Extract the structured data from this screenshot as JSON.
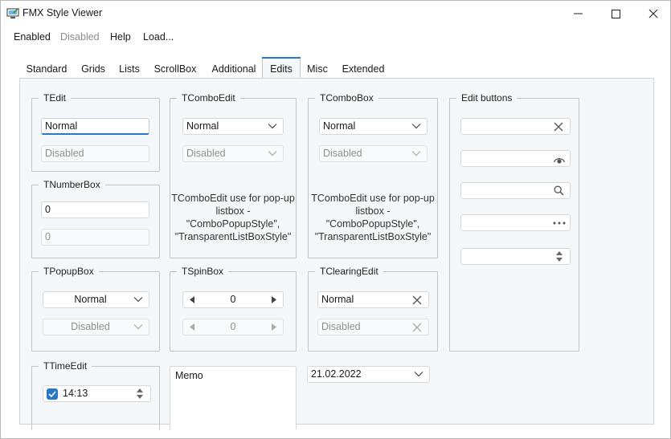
{
  "window": {
    "title": "FMX Style Viewer"
  },
  "menu": {
    "items": [
      "Enabled",
      "Disabled",
      "Help",
      "Load..."
    ]
  },
  "tabs": [
    "Standard",
    "Grids",
    "Lists",
    "ScrollBox",
    "Additional",
    "Edits",
    "Misc",
    "Extended"
  ],
  "active_tab": "Edits",
  "tedit": {
    "label": "TEdit",
    "normal_value": "Normal",
    "disabled_value": "Disabled"
  },
  "tnumberbox": {
    "label": "TNumberBox",
    "value": "0",
    "disabled_value": "0"
  },
  "tpopupbox": {
    "label": "TPopupBox",
    "normal_value": "Normal",
    "disabled_value": "Disabled"
  },
  "ttimeedit": {
    "label": "TTimeEdit",
    "value": "14:13"
  },
  "tcomboedit": {
    "label": "TComboEdit",
    "normal_value": "Normal",
    "disabled_value": "Disabled",
    "note_lines": [
      "TComboEdit use for pop-up",
      "listbox -",
      "\"ComboPopupStyle\",",
      "\"TransparentListBoxStyle\""
    ]
  },
  "tspinbox": {
    "label": "TSpinBox",
    "value": "0",
    "disabled_value": "0"
  },
  "memo": {
    "text": "Memo"
  },
  "tcombobox": {
    "label": "TComboBox",
    "normal_value": "Normal",
    "disabled_value": "Disabled",
    "note_lines": [
      "TComboEdit use for pop-up",
      "listbox -",
      "\"ComboPopupStyle\",",
      "\"TransparentListBoxStyle\""
    ]
  },
  "tclearingedit": {
    "label": "TClearingEdit",
    "normal_value": "Normal",
    "disabled_value": "Disabled"
  },
  "dateedit": {
    "value": "21.02.2022"
  },
  "editbuttons": {
    "label": "Edit buttons",
    "icons": [
      "clear-icon",
      "eye-icon",
      "search-icon",
      "ellipsis-icon",
      "spin-icon"
    ]
  },
  "colors": {
    "accent": "#2b76c8",
    "page_bg": "#f5f8fb",
    "border": "#bfc6cd"
  }
}
